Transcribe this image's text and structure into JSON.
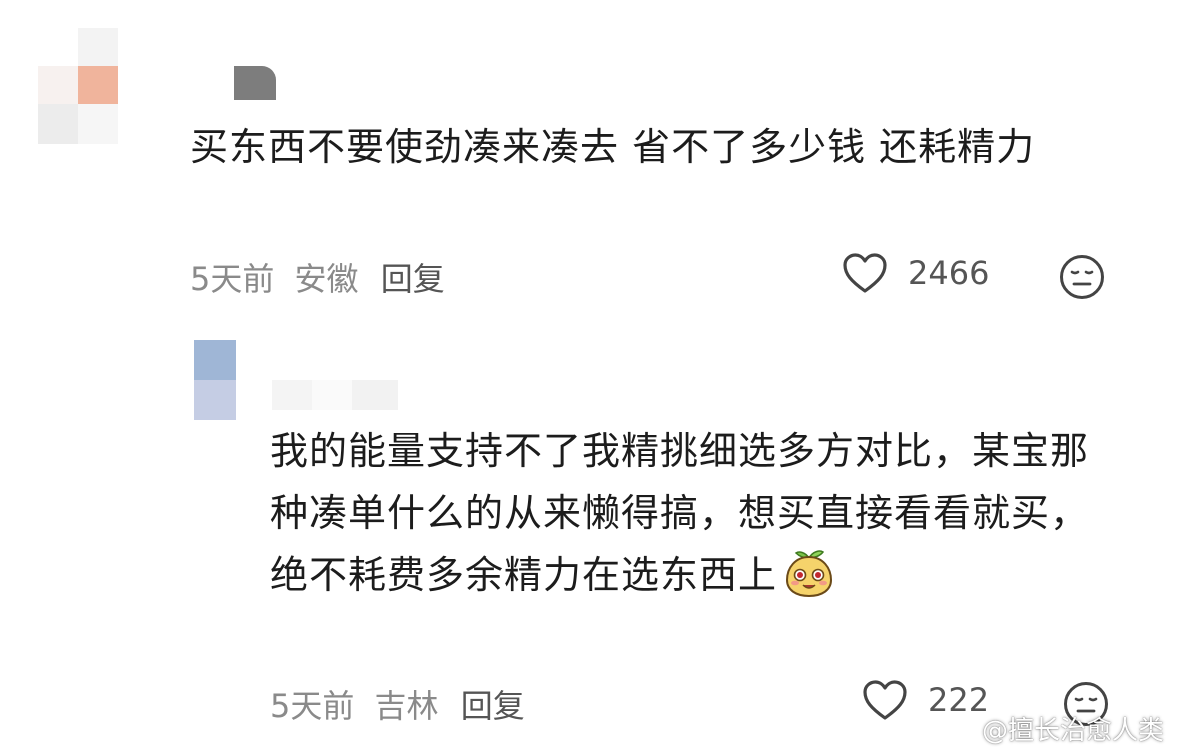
{
  "comments": [
    {
      "text": "买东西不要使劲凑来凑去 省不了多少钱 还耗精力",
      "time": "5天前",
      "location": "安徽",
      "reply_label": "回复",
      "likes": "2466"
    },
    {
      "text": "我的能量支持不了我精挑细选多方对比，某宝那种凑单什么的从来懒得搞，想买直接看看就买，绝不耗费多余精力在选东西上",
      "time": "5天前",
      "location": "吉林",
      "reply_label": "回复",
      "likes": "222"
    }
  ],
  "watermark": "@擅长治愈人类",
  "icons": {
    "like": "heart-outline-icon",
    "dislike": "neutral-face-icon",
    "emoji": "sprout-face-emoji-icon",
    "weibo": "weibo-logo-icon"
  },
  "colors": {
    "text": "#1c1c1c",
    "meta": "#8a8a8a",
    "icon": "#444444"
  }
}
